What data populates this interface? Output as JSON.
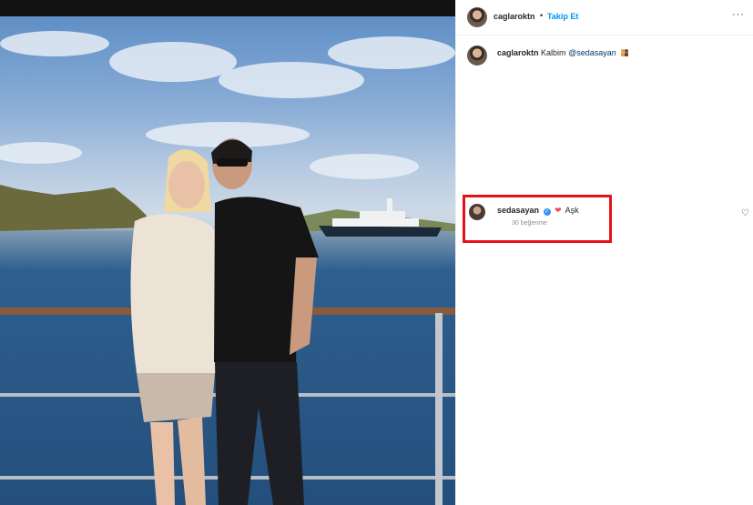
{
  "post": {
    "username": "caglaroktn",
    "dot": "•",
    "follow_label": "Takip Et",
    "more_icon": "more-horizontal-icon",
    "more_glyph": "···"
  },
  "caption": {
    "username": "caglaroktn",
    "text": "Kalbim",
    "mention": "@sedasayan"
  },
  "comment": {
    "username": "sedasayan",
    "verified_glyph": "✓",
    "heart_glyph": "❤",
    "text": "Aşk",
    "likes": "30 beğenme",
    "like_glyph": "♡",
    "highlight_color": "#e5121a"
  },
  "colors": {
    "follow": "#0095f6",
    "mention": "#00376b",
    "verified": "#3897f0"
  }
}
